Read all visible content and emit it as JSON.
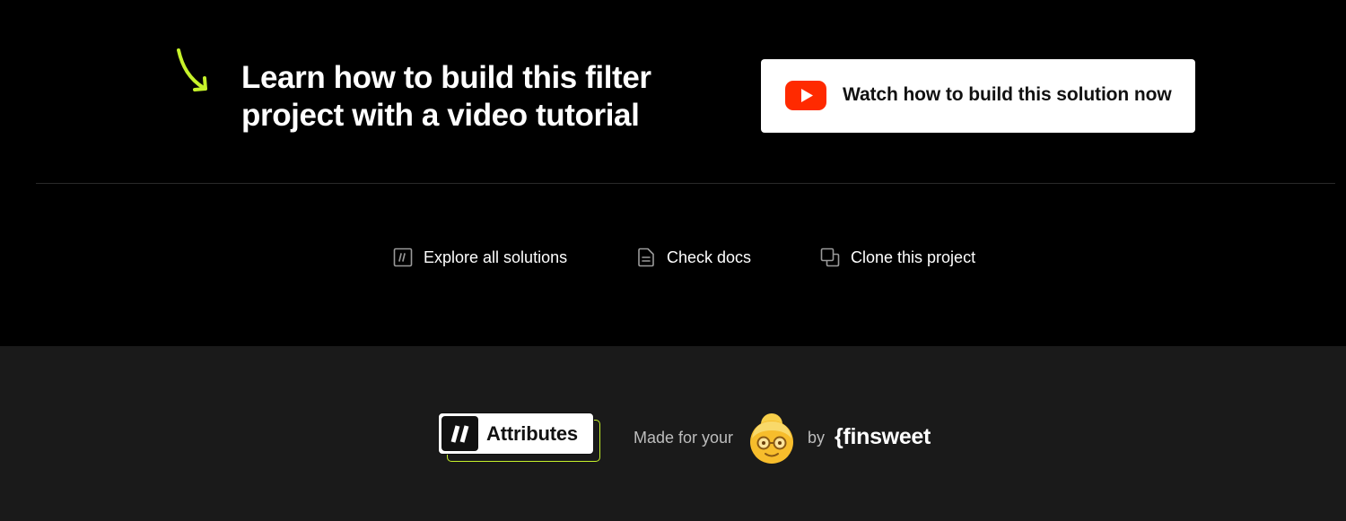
{
  "tutorial": {
    "headline": "Learn how to build this filter\nproject with a video tutorial",
    "watch_label": "Watch how to build this solution now",
    "accent_color": "#c6f22a",
    "youtube_color": "#ff2a00"
  },
  "links": [
    {
      "label": "Explore all solutions",
      "icon": "attributes-square-icon"
    },
    {
      "label": "Check docs",
      "icon": "document-icon"
    },
    {
      "label": "Clone this project",
      "icon": "clone-icon"
    }
  ],
  "footer": {
    "badge_label": "Attributes",
    "made_for": "Made for your",
    "emoji": "grandma-emoji",
    "by": "by",
    "brand": "{finsweet"
  }
}
